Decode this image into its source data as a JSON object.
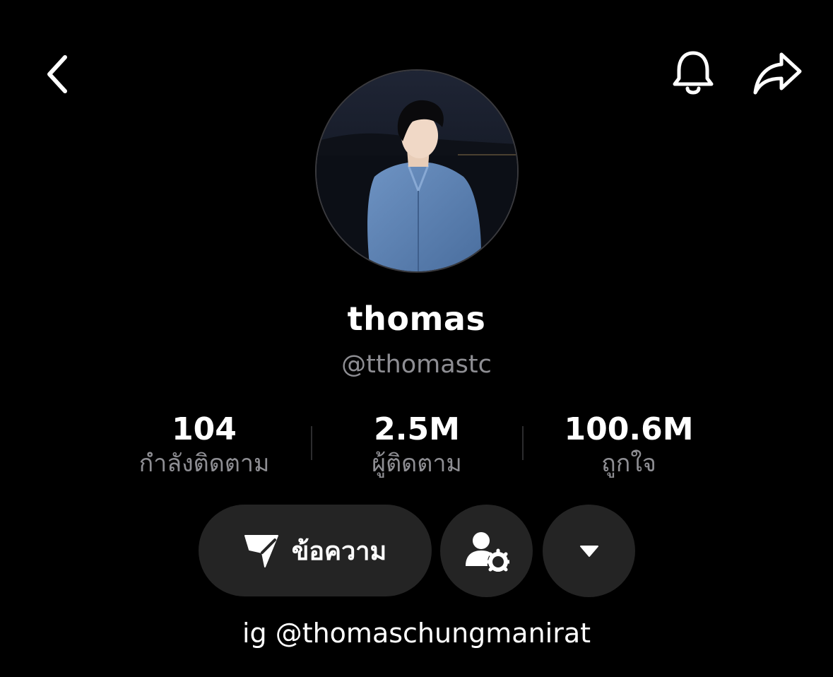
{
  "header": {
    "back_icon": "chevron-left-icon",
    "bell_icon": "bell-icon",
    "share_icon": "share-arrow-icon"
  },
  "profile": {
    "display_name": "thomas",
    "handle": "@tthomastc",
    "bio": "ig @thomaschungmanirat"
  },
  "stats": [
    {
      "value": "104",
      "label": "กำลังติดตาม"
    },
    {
      "value": "2.5M",
      "label": "ผู้ติดตาม"
    },
    {
      "value": "100.6M",
      "label": "ถูกใจ"
    }
  ],
  "actions": {
    "message_label": "ข้อความ",
    "message_icon": "paper-plane-icon",
    "friends_icon": "user-settings-icon",
    "more_icon": "caret-down-icon"
  },
  "colors": {
    "background": "#000000",
    "button_bg": "#242424",
    "secondary_text": "#8e8e93"
  }
}
